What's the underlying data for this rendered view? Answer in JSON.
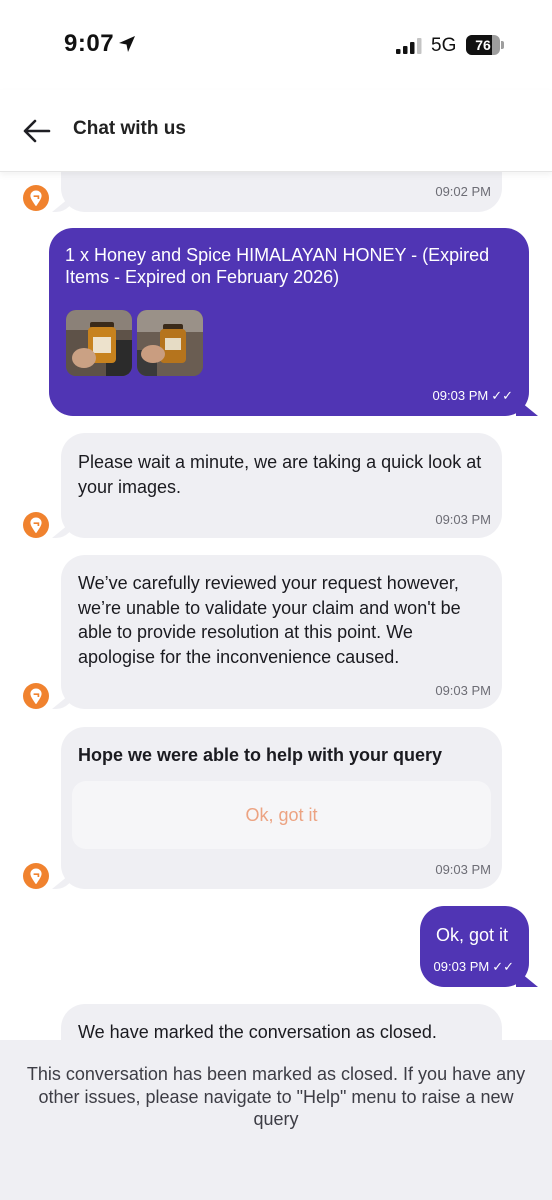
{
  "status_bar": {
    "time": "9:07",
    "network": "5G",
    "battery": "76",
    "battery_level": 0.76,
    "location_icon": "location-arrow-icon",
    "signal_icon": "cellular-signal-icon"
  },
  "header": {
    "title": "Chat with us",
    "back_icon": "arrow-left-icon"
  },
  "messages": [
    {
      "sender": "bot",
      "text": "",
      "time": "09:02 PM"
    },
    {
      "sender": "user",
      "text": "1 x Honey and Spice HIMALAYAN HONEY - (Expired Items - Expired on February 2026)",
      "attachments": 2,
      "time": "09:03 PM",
      "read": true
    },
    {
      "sender": "bot",
      "text": "Please wait a minute, we are taking a quick look at your images.",
      "time": "09:03 PM"
    },
    {
      "sender": "bot",
      "text": "We’ve carefully reviewed your request however, we’re unable to validate your claim and won't be able to provide resolution at this point. We apologise for the inconvenience caused.",
      "time": "09:03 PM"
    },
    {
      "sender": "bot",
      "text": "Hope we were able to help with your query",
      "button_label": "Ok, got it",
      "time": "09:03 PM"
    },
    {
      "sender": "user",
      "text": "Ok, got it",
      "time": "09:03 PM",
      "read": true
    },
    {
      "sender": "bot",
      "text": "We have marked the conversation as closed."
    }
  ],
  "closed_banner": {
    "text": "This conversation has been marked as closed. If you have any other issues, please navigate to \"Help\" menu to raise a new query"
  },
  "colors": {
    "accent": "#5035b4",
    "bot_bubble": "#efeff3",
    "avatar": "#f0822e",
    "quick_reply_text": "#eca382"
  }
}
